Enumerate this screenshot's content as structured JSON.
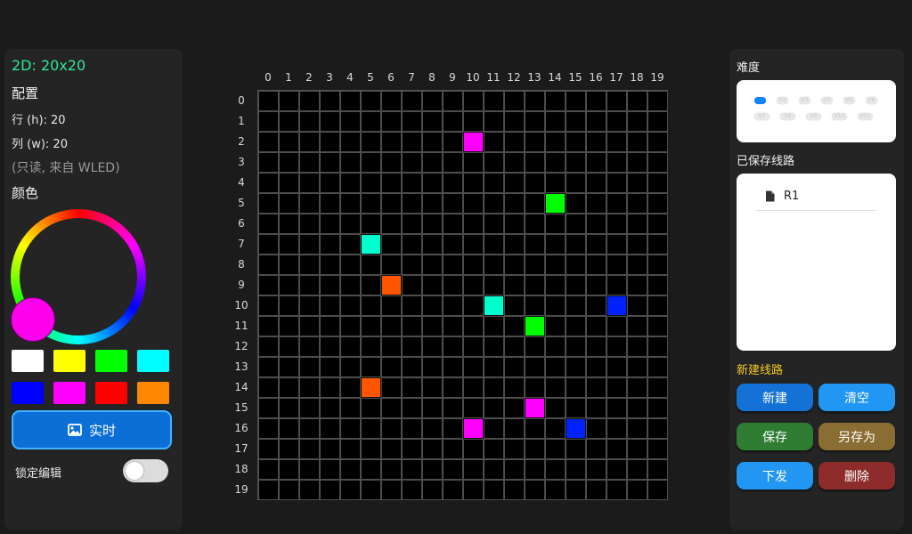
{
  "left_panel": {
    "matrix_title": "2D: 20x20",
    "config_heading": "配置",
    "rows_label": "行 (h): 20",
    "cols_label": "列 (w): 20",
    "readonly_note": "(只读, 来自 WLED)",
    "color_heading": "颜色",
    "selected_color": "#ff00ee",
    "swatches": [
      "#ffffff",
      "#ffff00",
      "#00ff00",
      "#00ffff",
      "#0000ff",
      "#ff00ff",
      "#ff0000",
      "#ff8800"
    ],
    "live_button_label": "实时",
    "live_icon": "image-icon",
    "lock_label": "锁定编辑",
    "lock_enabled": false
  },
  "grid": {
    "rows": 20,
    "cols": 20,
    "col_labels": [
      "0",
      "1",
      "2",
      "3",
      "4",
      "5",
      "6",
      "7",
      "8",
      "9",
      "10",
      "11",
      "12",
      "13",
      "14",
      "15",
      "16",
      "17",
      "18",
      "19"
    ],
    "row_labels": [
      "0",
      "1",
      "2",
      "3",
      "4",
      "5",
      "6",
      "7",
      "8",
      "9",
      "10",
      "11",
      "12",
      "13",
      "14",
      "15",
      "16",
      "17",
      "18",
      "19"
    ],
    "lit_cells": [
      {
        "row": 2,
        "col": 10,
        "color": "#ff00ff"
      },
      {
        "row": 5,
        "col": 14,
        "color": "#00ff00"
      },
      {
        "row": 7,
        "col": 5,
        "color": "#00ffcc"
      },
      {
        "row": 9,
        "col": 6,
        "color": "#ff5500"
      },
      {
        "row": 10,
        "col": 11,
        "color": "#00ffcc"
      },
      {
        "row": 10,
        "col": 17,
        "color": "#0022ff"
      },
      {
        "row": 11,
        "col": 13,
        "color": "#00ff00"
      },
      {
        "row": 14,
        "col": 5,
        "color": "#ff5500"
      },
      {
        "row": 15,
        "col": 13,
        "color": "#ff00ff"
      },
      {
        "row": 16,
        "col": 10,
        "color": "#ff00ff"
      },
      {
        "row": 16,
        "col": 15,
        "color": "#0022ff"
      }
    ]
  },
  "right_panel": {
    "difficulty_heading": "难度",
    "difficulty_selected": 1,
    "difficulty_levels": [
      "V1",
      "V2",
      "V3",
      "V4",
      "V5",
      "V6",
      "V7",
      "V8",
      "V9",
      "V10",
      "V11"
    ],
    "saved_heading": "已保存线路",
    "saved_routes": [
      {
        "label": "R1",
        "icon": "file-icon"
      }
    ],
    "new_route_heading": "新建线路",
    "buttons": {
      "new": "新建",
      "clear": "清空",
      "save": "保存",
      "save_as": "另存为",
      "send": "下发",
      "delete": "删除"
    }
  }
}
